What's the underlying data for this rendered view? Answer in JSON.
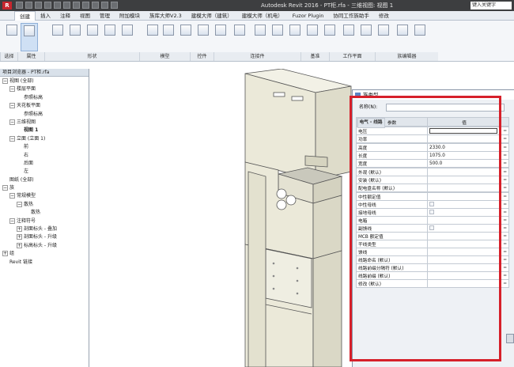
{
  "window": {
    "app_icon": "R",
    "title": "Autodesk Revit 2016 -     PT柜.rfa - 三维视图: 视图 1",
    "search_placeholder": "键入关键字"
  },
  "ribbon_tabs": [
    "创建",
    "插入",
    "注释",
    "视图",
    "管理",
    "附加模块",
    "族库大师V2.3",
    "建模大师（建筑）",
    "建模大师（机电）",
    "Fuzor Plugin",
    "协同工作族助手",
    "修改"
  ],
  "ribbon_groups": [
    "选择",
    "属性",
    "形状",
    "模型",
    "控件",
    "连接件",
    "基准",
    "工作平面",
    "族编辑器"
  ],
  "browser": {
    "header": "项目浏览器 - PT柜.rfa",
    "items": [
      {
        "label": "视图 (全部)",
        "toggle": "−",
        "indent": 0
      },
      {
        "label": "楼层平面",
        "toggle": "−",
        "indent": 1
      },
      {
        "label": "参照标高",
        "toggle": "",
        "indent": 2
      },
      {
        "label": "天花板平面",
        "toggle": "−",
        "indent": 1
      },
      {
        "label": "参照标高",
        "toggle": "",
        "indent": 2
      },
      {
        "label": "三维视图",
        "toggle": "−",
        "indent": 1
      },
      {
        "label": "视图 1",
        "toggle": "",
        "indent": 2,
        "bold": true
      },
      {
        "label": "立面 (立面 1)",
        "toggle": "−",
        "indent": 1
      },
      {
        "label": "前",
        "toggle": "",
        "indent": 2
      },
      {
        "label": "右",
        "toggle": "",
        "indent": 2
      },
      {
        "label": "后面",
        "toggle": "",
        "indent": 2
      },
      {
        "label": "左",
        "toggle": "",
        "indent": 2
      },
      {
        "label": "图纸 (全部)",
        "toggle": "",
        "indent": 0
      },
      {
        "label": "族",
        "toggle": "−",
        "indent": 0
      },
      {
        "label": "常规模型",
        "toggle": "−",
        "indent": 1
      },
      {
        "label": "散热",
        "toggle": "−",
        "indent": 2
      },
      {
        "label": "散热",
        "toggle": "",
        "indent": 3
      },
      {
        "label": "注释符号",
        "toggle": "−",
        "indent": 1
      },
      {
        "label": "剖面标头 - 叠加",
        "toggle": "+",
        "indent": 2
      },
      {
        "label": "剖面标头 - 升级",
        "toggle": "+",
        "indent": 2
      },
      {
        "label": "标高标头 - 升级",
        "toggle": "+",
        "indent": 2
      },
      {
        "label": "组",
        "toggle": "+",
        "indent": 0
      },
      {
        "label": "Revit 链接",
        "toggle": "",
        "indent": 0
      }
    ]
  },
  "dialog": {
    "title": "族类型",
    "name_label": "名称(N):",
    "col_param": "参数",
    "col_value": "值",
    "rows": [
      {
        "type": "group",
        "label": "电气"
      },
      {
        "type": "param",
        "label": "电压",
        "value": "",
        "edit": true
      },
      {
        "type": "param",
        "label": "功率",
        "value": ""
      },
      {
        "type": "group",
        "label": "尺寸标注"
      },
      {
        "type": "param",
        "label": "高度",
        "value": "2330.0"
      },
      {
        "type": "param",
        "label": "长度",
        "value": "1075.0"
      },
      {
        "type": "param",
        "label": "宽度",
        "value": "500.0"
      },
      {
        "type": "group",
        "label": "常规"
      },
      {
        "type": "param",
        "label": "外观 (默认)",
        "value": ""
      },
      {
        "type": "param",
        "label": "安装 (默认)",
        "value": ""
      },
      {
        "type": "param",
        "label": "配电盘名称 (默认)",
        "value": ""
      },
      {
        "type": "group",
        "label": "电气 - 线路"
      },
      {
        "type": "param",
        "label": "中性额定值",
        "value": ""
      },
      {
        "type": "param",
        "label": "中性母线",
        "value": "",
        "check": true
      },
      {
        "type": "param",
        "label": "接地母线",
        "value": "",
        "check": true
      },
      {
        "type": "param",
        "label": "电箱",
        "value": ""
      },
      {
        "type": "param",
        "label": "副馈线",
        "value": "",
        "check": true
      },
      {
        "type": "param",
        "label": "MCB 额定值",
        "value": ""
      },
      {
        "type": "param",
        "label": "干线类型",
        "value": ""
      },
      {
        "type": "param",
        "label": "馈线",
        "value": ""
      },
      {
        "type": "param",
        "label": "线路命名 (默认)",
        "value": ""
      },
      {
        "type": "param",
        "label": "线路前缀分隔符 (默认)",
        "value": ""
      },
      {
        "type": "param",
        "label": "线路前缀 (默认)",
        "value": ""
      },
      {
        "type": "param",
        "label": "修改 (默认)",
        "value": ""
      }
    ]
  },
  "colors": {
    "highlight": "#d6202a",
    "titlebar": "#3d3e40",
    "cabinet": "#ebe9d9"
  }
}
